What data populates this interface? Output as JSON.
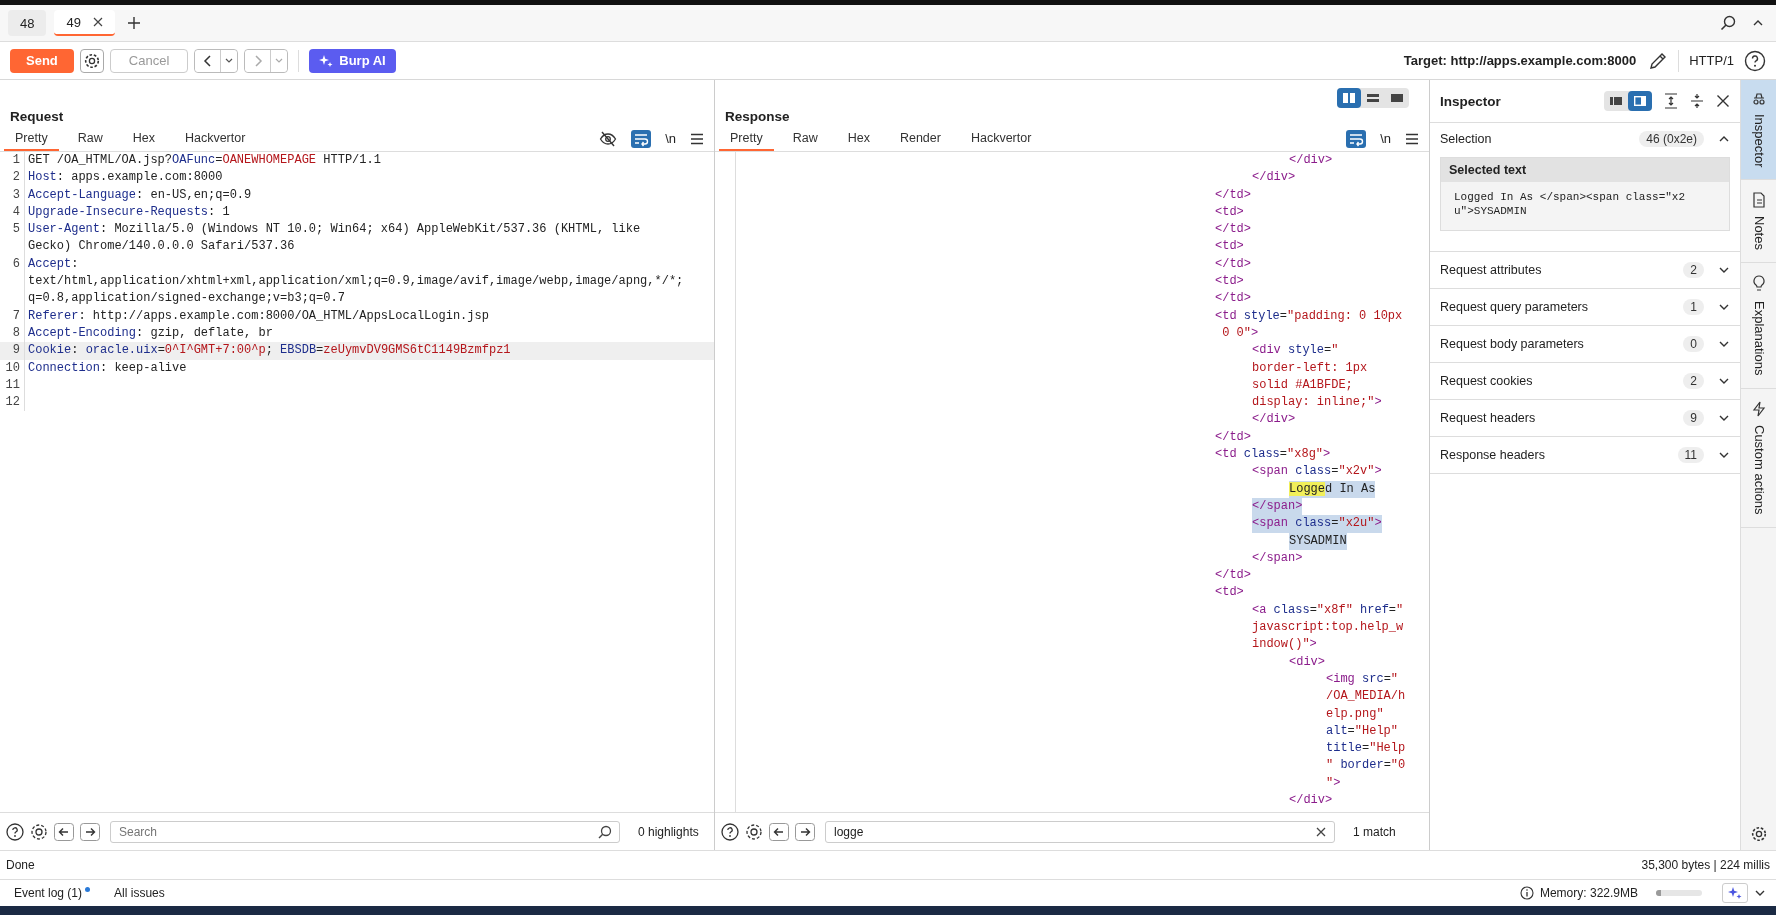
{
  "tabs": [
    {
      "label": "48",
      "selected": false
    },
    {
      "label": "49",
      "selected": true
    }
  ],
  "toolbar": {
    "send": "Send",
    "cancel": {
      "label": "Cancel",
      "disabled": true
    },
    "ai": "Burp AI",
    "target": "Target: http://apps.example.com:8000",
    "protocol": "HTTP/1"
  },
  "request": {
    "title": "Request",
    "tabs": [
      {
        "label": "Pretty",
        "selected": true
      },
      {
        "label": "Raw",
        "selected": false
      },
      {
        "label": "Hex",
        "selected": false
      },
      {
        "label": "Hackvertor",
        "selected": false
      }
    ],
    "wrap_on": true,
    "newline": "\\n",
    "lines": [
      {
        "number": "1",
        "selected": false,
        "rows": [
          [
            {
              "kind": "text",
              "text": "GET /OA_HTML/OA.jsp?"
            },
            {
              "kind": "param",
              "text": "OAFunc"
            },
            {
              "kind": "text",
              "text": "="
            },
            {
              "kind": "value",
              "text": "OANEWHOMEPAGE"
            },
            {
              "kind": "text",
              "text": " HTTP/1.1"
            }
          ]
        ]
      },
      {
        "number": "2",
        "selected": false,
        "rows": [
          [
            {
              "kind": "key",
              "text": "Host"
            },
            {
              "kind": "text",
              "text": ": apps.example.com:8000"
            }
          ]
        ]
      },
      {
        "number": "3",
        "selected": false,
        "rows": [
          [
            {
              "kind": "key",
              "text": "Accept-Language"
            },
            {
              "kind": "text",
              "text": ": en-US,en;q=0.9"
            }
          ]
        ]
      },
      {
        "number": "4",
        "selected": false,
        "rows": [
          [
            {
              "kind": "key",
              "text": "Upgrade-Insecure-Requests"
            },
            {
              "kind": "text",
              "text": ": 1"
            }
          ]
        ]
      },
      {
        "number": "5",
        "selected": false,
        "rows": [
          [
            {
              "kind": "key",
              "text": "User-Agent"
            },
            {
              "kind": "text",
              "text": ": Mozilla/5.0 (Windows NT 10.0; Win64; x64) AppleWebKit/537.36 (KHTML, like"
            }
          ],
          [
            {
              "kind": "text",
              "text": "Gecko) Chrome/140.0.0.0 Safari/537.36"
            }
          ]
        ]
      },
      {
        "number": "6",
        "selected": false,
        "rows": [
          [
            {
              "kind": "key",
              "text": "Accept"
            },
            {
              "kind": "text",
              "text": ":"
            }
          ],
          [
            {
              "kind": "text",
              "text": "text/html,application/xhtml+xml,application/xml;q=0.9,image/avif,image/webp,image/apng,*/*;"
            }
          ],
          [
            {
              "kind": "text",
              "text": "q=0.8,application/signed-exchange;v=b3;q=0.7"
            }
          ]
        ]
      },
      {
        "number": "7",
        "selected": false,
        "rows": [
          [
            {
              "kind": "key",
              "text": "Referer"
            },
            {
              "kind": "text",
              "text": ": http://apps.example.com:8000/OA_HTML/AppsLocalLogin.jsp"
            }
          ]
        ]
      },
      {
        "number": "8",
        "selected": false,
        "rows": [
          [
            {
              "kind": "key",
              "text": "Accept-Encoding"
            },
            {
              "kind": "text",
              "text": ": gzip, deflate, br"
            }
          ]
        ]
      },
      {
        "number": "9",
        "selected": true,
        "rows": [
          [
            {
              "kind": "key",
              "text": "Cookie"
            },
            {
              "kind": "text",
              "text": ": "
            },
            {
              "kind": "param",
              "text": "oracle.uix"
            },
            {
              "kind": "text",
              "text": "="
            },
            {
              "kind": "value",
              "text": "0^I^GMT+7:00^p"
            },
            {
              "kind": "text",
              "text": "; "
            },
            {
              "kind": "param",
              "text": "EBSDB"
            },
            {
              "kind": "text",
              "text": "="
            },
            {
              "kind": "value",
              "text": "zeUymvDV9GMS6tC1149Bzmfpz1"
            }
          ]
        ]
      },
      {
        "number": "10",
        "selected": false,
        "rows": [
          [
            {
              "kind": "key",
              "text": "Connection"
            },
            {
              "kind": "text",
              "text": ": keep-alive"
            }
          ]
        ]
      },
      {
        "number": "11",
        "selected": false,
        "rows": [
          []
        ]
      },
      {
        "number": "12",
        "selected": false,
        "rows": [
          []
        ]
      }
    ],
    "search": {
      "placeholder": "Search",
      "result": "0 highlights"
    }
  },
  "response": {
    "title": "Response",
    "layouts": [
      {
        "kind": "split",
        "selected": true
      },
      {
        "kind": "stacked",
        "selected": false
      },
      {
        "kind": "single",
        "selected": false
      }
    ],
    "tabs": [
      {
        "label": "Pretty",
        "selected": true
      },
      {
        "label": "Raw",
        "selected": false
      },
      {
        "label": "Hex",
        "selected": false
      },
      {
        "label": "Render",
        "selected": false
      },
      {
        "label": "Hackvertor",
        "selected": false
      }
    ],
    "wrap_on": true,
    "newline": "\\n",
    "code": [
      {
        "children": [
          {
            "children": [
              {
                "rows": [
                  {
                    "selected": false,
                    "tokens": [
                      {
                        "kind": "tag",
                        "text": "</div>"
                      }
                    ]
                  }
                ]
              }
            ]
          },
          {
            "rows": [
              {
                "selected": false,
                "tokens": [
                  {
                    "kind": "tag",
                    "text": "</div>"
                  }
                ]
              }
            ]
          }
        ]
      },
      {
        "rows": [
          {
            "selected": false,
            "tokens": [
              {
                "kind": "tag",
                "text": "</td>"
              }
            ]
          }
        ]
      },
      {
        "rows": [
          {
            "selected": false,
            "tokens": [
              {
                "kind": "tag",
                "text": "<td>"
              }
            ]
          }
        ]
      },
      {
        "rows": [
          {
            "selected": false,
            "tokens": [
              {
                "kind": "tag",
                "text": "</td>"
              }
            ]
          }
        ]
      },
      {
        "rows": [
          {
            "selected": false,
            "tokens": [
              {
                "kind": "tag",
                "text": "<td>"
              }
            ]
          }
        ]
      },
      {
        "rows": [
          {
            "selected": false,
            "tokens": [
              {
                "kind": "tag",
                "text": "</td>"
              }
            ]
          }
        ]
      },
      {
        "rows": [
          {
            "selected": false,
            "tokens": [
              {
                "kind": "tag",
                "text": "<td>"
              }
            ]
          }
        ]
      },
      {
        "rows": [
          {
            "selected": false,
            "tokens": [
              {
                "kind": "tag",
                "text": "</td>"
              }
            ]
          }
        ]
      },
      {
        "rows": [
          {
            "selected": false,
            "tokens": [
              {
                "kind": "tag",
                "text": "<td"
              },
              {
                "kind": "attr",
                "text": " style"
              },
              {
                "kind": "text",
                "text": "="
              },
              {
                "kind": "value",
                "text": "\"padding: 0 10px"
              }
            ]
          },
          {
            "selected": false,
            "tokens": [
              {
                "kind": "value",
                "text": " 0 0\""
              },
              {
                "kind": "tag",
                "text": ">"
              }
            ]
          }
        ],
        "children": [
          {
            "rows": [
              {
                "selected": false,
                "tokens": [
                  {
                    "kind": "tag",
                    "text": "<div"
                  },
                  {
                    "kind": "attr",
                    "text": " style"
                  },
                  {
                    "kind": "text",
                    "text": "="
                  },
                  {
                    "kind": "value",
                    "text": "\""
                  }
                ]
              },
              {
                "selected": false,
                "tokens": [
                  {
                    "kind": "value",
                    "text": "border-left: 1px"
                  }
                ]
              },
              {
                "selected": false,
                "tokens": [
                  {
                    "kind": "value",
                    "text": "solid #A1BFDE;"
                  }
                ]
              },
              {
                "selected": false,
                "tokens": [
                  {
                    "kind": "value",
                    "text": "display: inline;\""
                  },
                  {
                    "kind": "tag",
                    "text": ">"
                  }
                ]
              }
            ]
          },
          {
            "rows": [
              {
                "selected": false,
                "tokens": [
                  {
                    "kind": "tag",
                    "text": "</div>"
                  }
                ]
              }
            ]
          }
        ]
      },
      {
        "rows": [
          {
            "selected": false,
            "tokens": [
              {
                "kind": "tag",
                "text": "</td>"
              }
            ]
          }
        ]
      },
      {
        "rows": [
          {
            "selected": false,
            "tokens": [
              {
                "kind": "tag",
                "text": "<td"
              },
              {
                "kind": "attr",
                "text": " class"
              },
              {
                "kind": "text",
                "text": "="
              },
              {
                "kind": "value",
                "text": "\"x8g\""
              },
              {
                "kind": "tag",
                "text": ">"
              }
            ]
          }
        ],
        "children": [
          {
            "rows": [
              {
                "selected": false,
                "tokens": [
                  {
                    "kind": "tag",
                    "text": "<span"
                  },
                  {
                    "kind": "attr",
                    "text": " class"
                  },
                  {
                    "kind": "text",
                    "text": "="
                  },
                  {
                    "kind": "value",
                    "text": "\"x2v\""
                  },
                  {
                    "kind": "tag",
                    "text": ">"
                  }
                ]
              }
            ],
            "children": [
              {
                "rows": [
                  {
                    "selected": true,
                    "tokens": [
                      {
                        "kind": "match",
                        "text": "Logge"
                      },
                      {
                        "kind": "text",
                        "text": "d In As"
                      }
                    ]
                  }
                ]
              }
            ]
          },
          {
            "rows": [
              {
                "selected": true,
                "tokens": [
                  {
                    "kind": "tag",
                    "text": "</span>"
                  }
                ]
              }
            ]
          },
          {
            "rows": [
              {
                "selected": true,
                "tokens": [
                  {
                    "kind": "tag",
                    "text": "<span"
                  },
                  {
                    "kind": "attr",
                    "text": " class"
                  },
                  {
                    "kind": "text",
                    "text": "="
                  },
                  {
                    "kind": "value",
                    "text": "\"x2u\""
                  },
                  {
                    "kind": "tag",
                    "text": ">"
                  }
                ]
              }
            ],
            "children": [
              {
                "rows": [
                  {
                    "selected": true,
                    "tokens": [
                      {
                        "kind": "text",
                        "text": "SYSADMIN"
                      }
                    ]
                  }
                ]
              }
            ]
          },
          {
            "rows": [
              {
                "selected": false,
                "tokens": [
                  {
                    "kind": "tag",
                    "text": "</span>"
                  }
                ]
              }
            ]
          }
        ]
      },
      {
        "rows": [
          {
            "selected": false,
            "tokens": [
              {
                "kind": "tag",
                "text": "</td>"
              }
            ]
          }
        ]
      },
      {
        "rows": [
          {
            "selected": false,
            "tokens": [
              {
                "kind": "tag",
                "text": "<td>"
              }
            ]
          }
        ],
        "children": [
          {
            "rows": [
              {
                "selected": false,
                "tokens": [
                  {
                    "kind": "tag",
                    "text": "<a"
                  },
                  {
                    "kind": "attr",
                    "text": " class"
                  },
                  {
                    "kind": "text",
                    "text": "="
                  },
                  {
                    "kind": "value",
                    "text": "\"x8f\""
                  },
                  {
                    "kind": "attr",
                    "text": " href"
                  },
                  {
                    "kind": "text",
                    "text": "="
                  },
                  {
                    "kind": "value",
                    "text": "\""
                  }
                ]
              },
              {
                "selected": false,
                "tokens": [
                  {
                    "kind": "value",
                    "text": "javascript:top.help_w"
                  }
                ]
              },
              {
                "selected": false,
                "tokens": [
                  {
                    "kind": "value",
                    "text": "indow()\""
                  },
                  {
                    "kind": "tag",
                    "text": ">"
                  }
                ]
              }
            ],
            "children": [
              {
                "rows": [
                  {
                    "selected": false,
                    "tokens": [
                      {
                        "kind": "tag",
                        "text": "<div>"
                      }
                    ]
                  }
                ],
                "children": [
                  {
                    "rows": [
                      {
                        "selected": false,
                        "tokens": [
                          {
                            "kind": "tag",
                            "text": "<img"
                          },
                          {
                            "kind": "attr",
                            "text": " src"
                          },
                          {
                            "kind": "text",
                            "text": "="
                          },
                          {
                            "kind": "value",
                            "text": "\""
                          }
                        ]
                      },
                      {
                        "selected": false,
                        "tokens": [
                          {
                            "kind": "value",
                            "text": "/OA_MEDIA/h"
                          }
                        ]
                      },
                      {
                        "selected": false,
                        "tokens": [
                          {
                            "kind": "value",
                            "text": "elp.png\""
                          }
                        ]
                      },
                      {
                        "selected": false,
                        "tokens": [
                          {
                            "kind": "attr",
                            "text": "alt"
                          },
                          {
                            "kind": "text",
                            "text": "="
                          },
                          {
                            "kind": "value",
                            "text": "\"Help\""
                          }
                        ]
                      },
                      {
                        "selected": false,
                        "tokens": [
                          {
                            "kind": "attr",
                            "text": "title"
                          },
                          {
                            "kind": "text",
                            "text": "="
                          },
                          {
                            "kind": "value",
                            "text": "\"Help"
                          }
                        ]
                      },
                      {
                        "selected": false,
                        "tokens": [
                          {
                            "kind": "value",
                            "text": "\""
                          },
                          {
                            "kind": "attr",
                            "text": " border"
                          },
                          {
                            "kind": "text",
                            "text": "="
                          },
                          {
                            "kind": "value",
                            "text": "\"0"
                          }
                        ]
                      },
                      {
                        "selected": false,
                        "tokens": [
                          {
                            "kind": "value",
                            "text": "\""
                          },
                          {
                            "kind": "tag",
                            "text": ">"
                          }
                        ]
                      }
                    ]
                  }
                ]
              },
              {
                "rows": [
                  {
                    "selected": false,
                    "tokens": [
                      {
                        "kind": "tag",
                        "text": "</div>"
                      }
                    ]
                  }
                ]
              }
            ]
          }
        ]
      }
    ],
    "search": {
      "value": "logge",
      "result": "1 match"
    }
  },
  "inspector": {
    "title": "Inspector",
    "layouts": [
      {
        "kind": "stacked",
        "selected": false
      },
      {
        "kind": "side",
        "selected": true
      }
    ],
    "selection": {
      "label": "Selection",
      "count": "46 (0x2e)",
      "expanded": true,
      "heading": "Selected text",
      "text": "Logged In As </span><span class=\"x2u\">SYSADMIN"
    },
    "sections": [
      {
        "label": "Request attributes",
        "count": "2",
        "expanded": false
      },
      {
        "label": "Request query parameters",
        "count": "1",
        "expanded": false
      },
      {
        "label": "Request body parameters",
        "count": "0",
        "expanded": false
      },
      {
        "label": "Request cookies",
        "count": "2",
        "expanded": false
      },
      {
        "label": "Request headers",
        "count": "9",
        "expanded": false
      },
      {
        "label": "Response headers",
        "count": "11",
        "expanded": false
      }
    ]
  },
  "side_tabs": [
    {
      "kind": "inspector",
      "label": "Inspector",
      "selected": true
    },
    {
      "kind": "notes",
      "label": "Notes",
      "selected": false
    },
    {
      "kind": "explanations",
      "label": "Explanations",
      "selected": false
    },
    {
      "kind": "actions",
      "label": "Custom actions",
      "selected": false
    }
  ],
  "status": {
    "left": "Done",
    "right": "35,300 bytes | 224 millis"
  },
  "bottom_bar": {
    "event_log": "Event log (1)",
    "event_unread": true,
    "issues": "All issues",
    "memory": {
      "label": "Memory: 322.9MB",
      "level": 0.1
    }
  }
}
